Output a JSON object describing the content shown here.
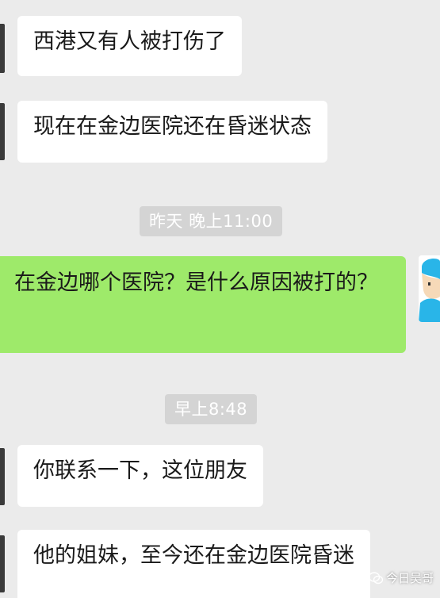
{
  "messages_top": [
    {
      "text": "西港又有人被打伤了"
    },
    {
      "text": "现在在金边医院还在昏迷状态"
    }
  ],
  "timestamp_1": "昨天 晚上11:00",
  "outgoing": {
    "text": "在金边哪个医院？是什么原因被打的？"
  },
  "timestamp_2": "早上8:48",
  "messages_bottom": [
    {
      "text": "你联系一下，这位朋友"
    },
    {
      "text": "他的姐妹，至今还在金边医院昏迷"
    }
  ],
  "watermark": {
    "text": "今日吴哥",
    "icon": "wechat-icon"
  },
  "colors": {
    "background": "#ebebeb",
    "incoming_bubble": "#ffffff",
    "outgoing_bubble": "#9eea6a",
    "timestamp_bg": "#d4d4d4"
  }
}
